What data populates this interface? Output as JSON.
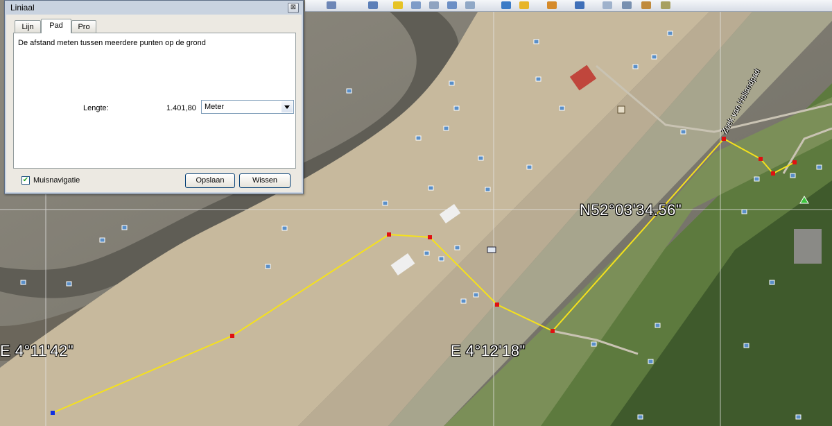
{
  "dialog": {
    "title": "Liniaal",
    "close_glyph": "⊠",
    "tabs": [
      {
        "label": "Lijn",
        "active": false
      },
      {
        "label": "Pad",
        "active": true
      },
      {
        "label": "Pro",
        "active": false
      }
    ],
    "description": "De afstand meten tussen meerdere punten op de grond",
    "length_label": "Lengte:",
    "length_value": "1.401,80",
    "unit_selected": "Meter",
    "mouse_nav_label": "Muisnavigatie",
    "mouse_nav_checked": true,
    "save_label": "Opslaan",
    "clear_label": "Wissen"
  },
  "map": {
    "coord_lon_left": "E  4°11'42\"",
    "coord_lon_mid": "E  4°12'18\"",
    "coord_lat": "N52°03'34.56\"",
    "road_label": "Zoek van Hollandpad",
    "path_color": "#f5e11c",
    "vertex_color": "#e01010",
    "start_color": "#1030e0"
  },
  "toolbar": {
    "icons": [
      "search-icon",
      "sidebar-icon",
      "placemark-icon",
      "polygon-icon",
      "path-icon",
      "overlay-icon",
      "record-tour-icon",
      "history-icon",
      "sun-icon",
      "planets-icon",
      "ruler-icon",
      "email-icon",
      "print-icon",
      "maps-icon",
      "kml-icon"
    ]
  }
}
